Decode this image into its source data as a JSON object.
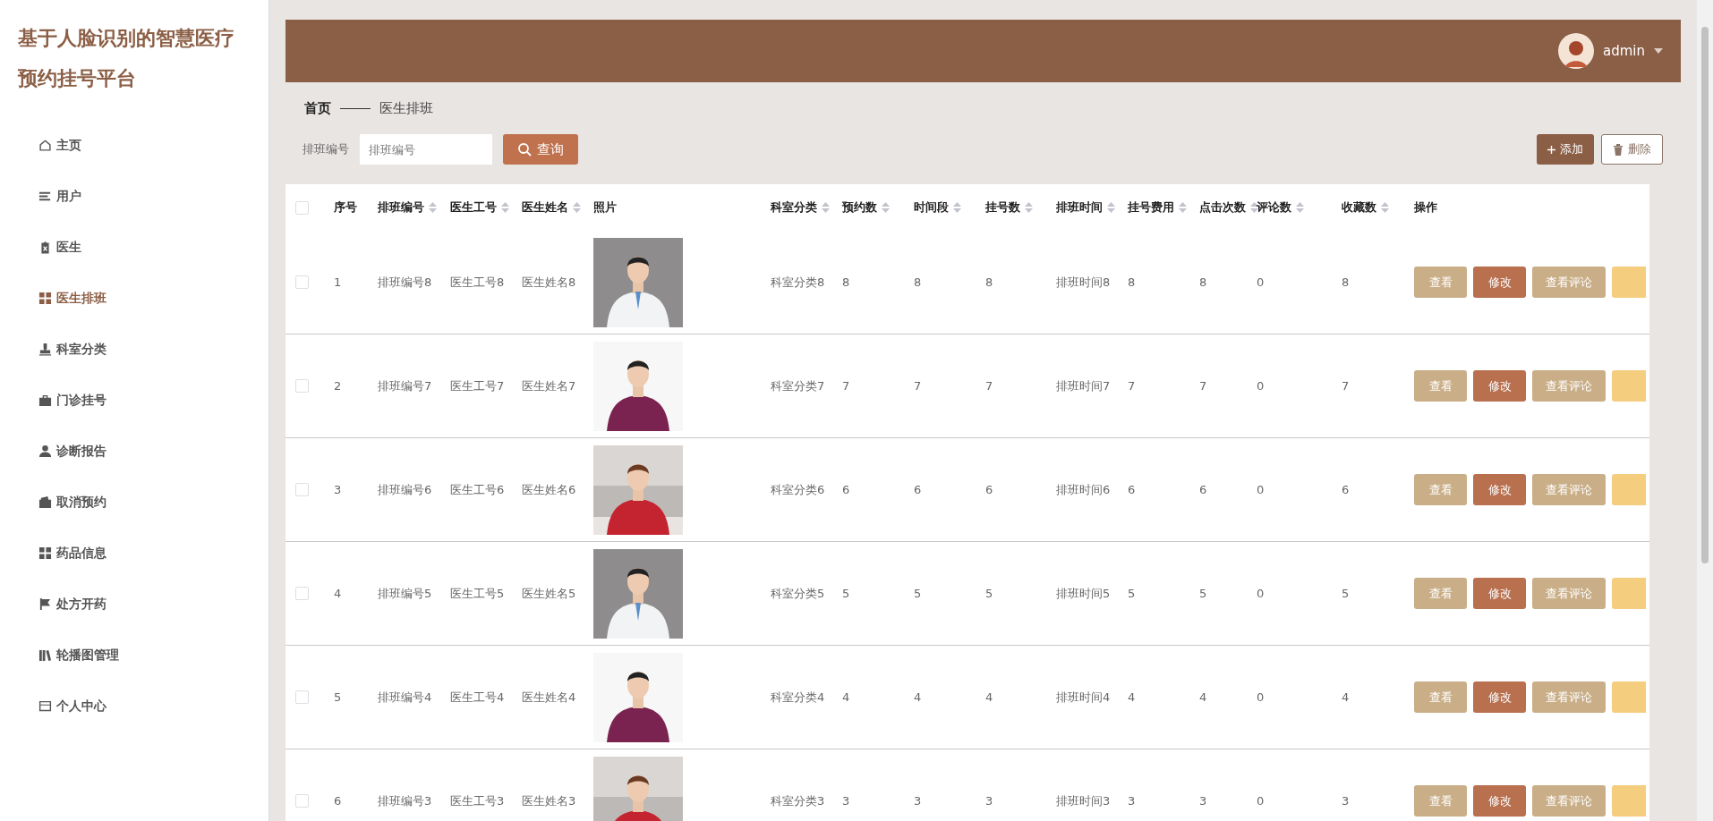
{
  "sidebar": {
    "title": "基于人脸识别的智慧医疗预约挂号平台",
    "items": [
      {
        "label": "主页",
        "selected": false
      },
      {
        "label": "用户",
        "selected": false
      },
      {
        "label": "医生",
        "selected": false
      },
      {
        "label": "医生排班",
        "selected": true
      },
      {
        "label": "科室分类",
        "selected": false
      },
      {
        "label": "门诊挂号",
        "selected": false
      },
      {
        "label": "诊断报告",
        "selected": false
      },
      {
        "label": "取消预约",
        "selected": false
      },
      {
        "label": "药品信息",
        "selected": false
      },
      {
        "label": "处方开药",
        "selected": false
      },
      {
        "label": "轮播图管理",
        "selected": false
      },
      {
        "label": "个人中心",
        "selected": false
      }
    ]
  },
  "header": {
    "user": "admin"
  },
  "breadcrumb": [
    "首页",
    "医生排班"
  ],
  "search": {
    "label": "排班编号",
    "placeholder": "排班编号",
    "button": "查询"
  },
  "toolbar": [
    {
      "label": "添加",
      "kind": "add"
    },
    {
      "label": "删除",
      "kind": "delete"
    }
  ],
  "table": {
    "select_all": {
      "checked": false
    },
    "columns": [
      {
        "label": "序号",
        "sortable": false,
        "kind": "text"
      },
      {
        "label": "排班编号",
        "sortable": true,
        "kind": "text"
      },
      {
        "label": "医生工号",
        "sortable": true,
        "kind": "text"
      },
      {
        "label": "医生姓名",
        "sortable": true,
        "kind": "text"
      },
      {
        "label": "照片",
        "sortable": false,
        "kind": "picture"
      },
      {
        "label": "科室分类",
        "sortable": true,
        "kind": "text"
      },
      {
        "label": "预约数",
        "sortable": true,
        "kind": "text"
      },
      {
        "label": "时间段",
        "sortable": true,
        "kind": "text"
      },
      {
        "label": "挂号数",
        "sortable": true,
        "kind": "text"
      },
      {
        "label": "排班时间",
        "sortable": true,
        "kind": "text"
      },
      {
        "label": "挂号费用",
        "sortable": true,
        "kind": "text"
      },
      {
        "label": "点击次数",
        "sortable": true,
        "kind": "text"
      },
      {
        "label": "评论数",
        "sortable": true,
        "kind": "text"
      },
      {
        "label": "收藏数",
        "sortable": true,
        "kind": "text"
      },
      {
        "label": "操作",
        "sortable": false,
        "kind": "actions"
      }
    ],
    "rows": [
      {
        "checked": false,
        "cells": [
          "1",
          "排班编号8",
          "医生工号8",
          "医生姓名8",
          {
            "kind": "picture"
          },
          "科室分类8",
          "8",
          "8",
          "8",
          "排班时间8",
          "8",
          "8",
          "0",
          "8",
          [
            {
              "label": "查看",
              "kind": "view"
            },
            {
              "label": "修改",
              "kind": "edit"
            },
            {
              "label": "查看评论",
              "kind": "comments"
            },
            {
              "kind": "delete"
            }
          ]
        ]
      },
      {
        "checked": false,
        "cells": [
          "2",
          "排班编号7",
          "医生工号7",
          "医生姓名7",
          {
            "kind": "picture"
          },
          "科室分类7",
          "7",
          "7",
          "7",
          "排班时间7",
          "7",
          "7",
          "0",
          "7",
          [
            {
              "label": "查看",
              "kind": "view"
            },
            {
              "label": "修改",
              "kind": "edit"
            },
            {
              "label": "查看评论",
              "kind": "comments"
            },
            {
              "kind": "delete"
            }
          ]
        ]
      },
      {
        "checked": false,
        "cells": [
          "3",
          "排班编号6",
          "医生工号6",
          "医生姓名6",
          {
            "kind": "picture"
          },
          "科室分类6",
          "6",
          "6",
          "6",
          "排班时间6",
          "6",
          "6",
          "0",
          "6",
          [
            {
              "label": "查看",
              "kind": "view"
            },
            {
              "label": "修改",
              "kind": "edit"
            },
            {
              "label": "查看评论",
              "kind": "comments"
            },
            {
              "kind": "delete"
            }
          ]
        ]
      },
      {
        "checked": false,
        "cells": [
          "4",
          "排班编号5",
          "医生工号5",
          "医生姓名5",
          {
            "kind": "picture"
          },
          "科室分类5",
          "5",
          "5",
          "5",
          "排班时间5",
          "5",
          "5",
          "0",
          "5",
          [
            {
              "label": "查看",
              "kind": "view"
            },
            {
              "label": "修改",
              "kind": "edit"
            },
            {
              "label": "查看评论",
              "kind": "comments"
            },
            {
              "kind": "delete"
            }
          ]
        ]
      },
      {
        "checked": false,
        "cells": [
          "5",
          "排班编号4",
          "医生工号4",
          "医生姓名4",
          {
            "kind": "picture"
          },
          "科室分类4",
          "4",
          "4",
          "4",
          "排班时间4",
          "4",
          "4",
          "0",
          "4",
          [
            {
              "label": "查看",
              "kind": "view"
            },
            {
              "label": "修改",
              "kind": "edit"
            },
            {
              "label": "查看评论",
              "kind": "comments"
            },
            {
              "kind": "delete"
            }
          ]
        ]
      },
      {
        "checked": false,
        "cells": [
          "6",
          "排班编号3",
          "医生工号3",
          "医生姓名3",
          {
            "kind": "picture"
          },
          "科室分类3",
          "3",
          "3",
          "3",
          "排班时间3",
          "3",
          "3",
          "0",
          "3",
          [
            {
              "label": "查看",
              "kind": "view"
            },
            {
              "label": "修改",
              "kind": "edit"
            },
            {
              "label": "查看评论",
              "kind": "comments"
            },
            {
              "kind": "delete"
            }
          ]
        ]
      }
    ]
  }
}
